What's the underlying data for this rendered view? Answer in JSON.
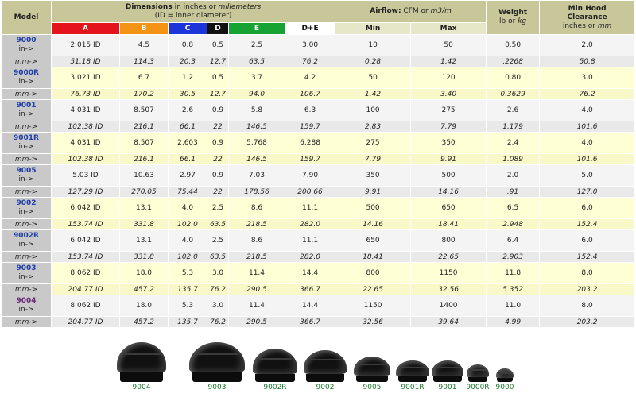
{
  "headers": {
    "model": "Model",
    "dim_title_a": "Dimensions",
    "dim_title_b": " in inches or ",
    "dim_title_c": "millemeters",
    "dim_sub": "(ID = inner diameter)",
    "airflow_a": "Airflow:",
    "airflow_b": " CFM or ",
    "airflow_c": "m3/m",
    "weight": "Weight",
    "weight_sub": "lb or ",
    "weight_sub_i": "kg",
    "hood_1": "Min Hood",
    "hood_2": "Clearance",
    "hood_3": "inches or ",
    "hood_3i": "mm",
    "cols": [
      "A",
      "B",
      "C",
      "D",
      "E",
      "D+E"
    ],
    "col_colors": [
      "#e3141b",
      "#f39415",
      "#1c35d8",
      "#111111",
      "#17a234",
      "#ffffff"
    ],
    "col_text": [
      "#ffffff",
      "#ffffff",
      "#ffffff",
      "#ffffff",
      "#ffffff",
      "#111111"
    ],
    "min": "Min",
    "max": "Max",
    "in_label": "in->",
    "mm_label": "mm->"
  },
  "rows": [
    {
      "model": "9000",
      "in": [
        "2.015 ID",
        "4.5",
        "0.8",
        "0.5",
        "2.5",
        "3.00",
        "10",
        "50",
        "0.50",
        "2.0"
      ],
      "mm": [
        "51.18 ID",
        "114.3",
        "20.3",
        "12.7",
        "63.5",
        "76.2",
        "0.28",
        "1.42",
        ".2268",
        "50.8"
      ]
    },
    {
      "model": "9000R",
      "in": [
        "3.021 ID",
        "6.7",
        "1.2",
        "0.5",
        "3.7",
        "4.2",
        "50",
        "120",
        "0.80",
        "3.0"
      ],
      "mm": [
        "76.73 ID",
        "170.2",
        "30.5",
        "12.7",
        "94.0",
        "106.7",
        "1.42",
        "3.40",
        "0.3629",
        "76.2"
      ]
    },
    {
      "model": "9001",
      "in": [
        "4.031 ID",
        "8.507",
        "2.6",
        "0.9",
        "5.8",
        "6.3",
        "100",
        "275",
        "2.6",
        "4.0"
      ],
      "mm": [
        "102.38 ID",
        "216.1",
        "66.1",
        "22",
        "146.5",
        "159.7",
        "2.83",
        "7.79",
        "1.179",
        "101.6"
      ]
    },
    {
      "model": "9001R",
      "in": [
        "4.031 ID",
        "8.507",
        "2.603",
        "0.9",
        "5.768",
        "6.288",
        "275",
        "350",
        "2.4",
        "4.0"
      ],
      "mm": [
        "102.38 ID",
        "216.1",
        "66.1",
        "22",
        "146.5",
        "159.7",
        "7.79",
        "9.91",
        "1.089",
        "101.6"
      ]
    },
    {
      "model": "9005",
      "in": [
        "5.03 ID",
        "10.63",
        "2.97",
        "0.9",
        "7.03",
        "7.90",
        "350",
        "500",
        "2.0",
        "5.0"
      ],
      "mm": [
        "127.29 ID",
        "270.05",
        "75.44",
        "22",
        "178.56",
        "200.66",
        "9.91",
        "14.16",
        ".91",
        "127.0"
      ]
    },
    {
      "model": "9002",
      "in": [
        "6.042 ID",
        "13.1",
        "4.0",
        "2.5",
        "8.6",
        "11.1",
        "500",
        "650",
        "6.5",
        "6.0"
      ],
      "mm": [
        "153.74 ID",
        "331.8",
        "102.0",
        "63.5",
        "218.5",
        "282.0",
        "14.16",
        "18.41",
        "2.948",
        "152.4"
      ]
    },
    {
      "model": "9002R",
      "in": [
        "6.042 ID",
        "13.1",
        "4.0",
        "2.5",
        "8.6",
        "11.1",
        "650",
        "800",
        "6.4",
        "6.0"
      ],
      "mm": [
        "153.74 ID",
        "331.8",
        "102.0",
        "63.5",
        "218.5",
        "282.0",
        "18.41",
        "22.65",
        "2.903",
        "152.4"
      ]
    },
    {
      "model": "9003",
      "in": [
        "8.062 ID",
        "18.0",
        "5.3",
        "3.0",
        "11.4",
        "14.4",
        "800",
        "1150",
        "11.8",
        "8.0"
      ],
      "mm": [
        "204.77 ID",
        "457.2",
        "135.7",
        "76.2",
        "290.5",
        "366.7",
        "22.65",
        "32.56",
        "5.352",
        "203.2"
      ]
    },
    {
      "model": "9004",
      "in": [
        "8.062 ID",
        "18.0",
        "5.3",
        "3.0",
        "11.4",
        "14.4",
        "1150",
        "1400",
        "11.0",
        "8.0"
      ],
      "mm": [
        "204.77 ID",
        "457.2",
        "135.7",
        "76.2",
        "290.5",
        "366.7",
        "32.56",
        "39.64",
        "4.99",
        "203.2"
      ]
    }
  ],
  "gallery": [
    "9004",
    "9003",
    "9002R",
    "9002",
    "9005",
    "9001R",
    "9001",
    "9000R",
    "9000"
  ]
}
